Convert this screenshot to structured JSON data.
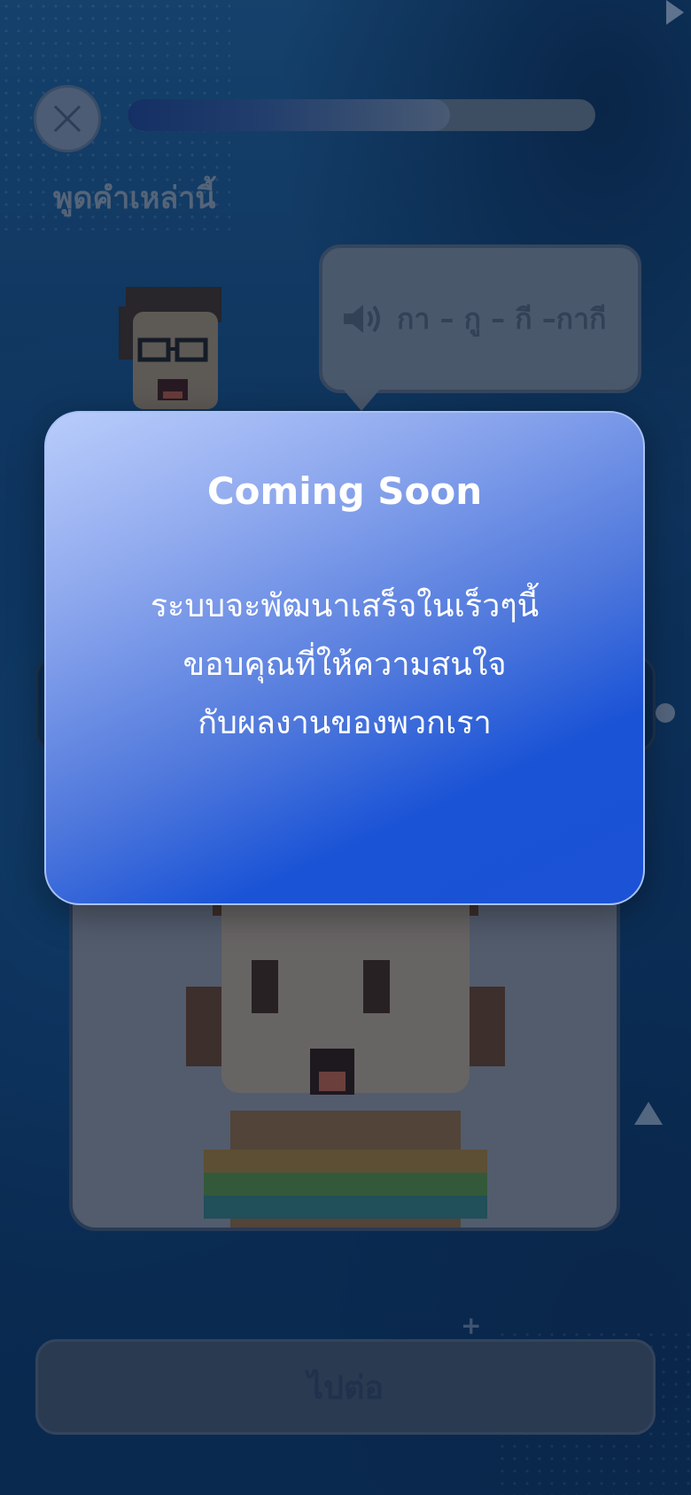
{
  "header": {
    "progress_fraction": 0.69,
    "prompt_title": "พูดคำเหล่านี้"
  },
  "speech": {
    "icon": "speaker-icon",
    "text": "กา – กู – กี –กากี"
  },
  "footer": {
    "next_label": "ไปต่อ"
  },
  "modal": {
    "title": "Coming Soon",
    "lines": [
      "ระบบจะพัฒนาเสร็จในเร็วๆนี้",
      "ขอบคุณที่ให้ความสนใจ",
      "กับผลงานของพวกเรา"
    ]
  },
  "colors": {
    "modal_start": "#b9cdfb",
    "modal_end": "#1b52d6",
    "background": "#0f3b68"
  }
}
